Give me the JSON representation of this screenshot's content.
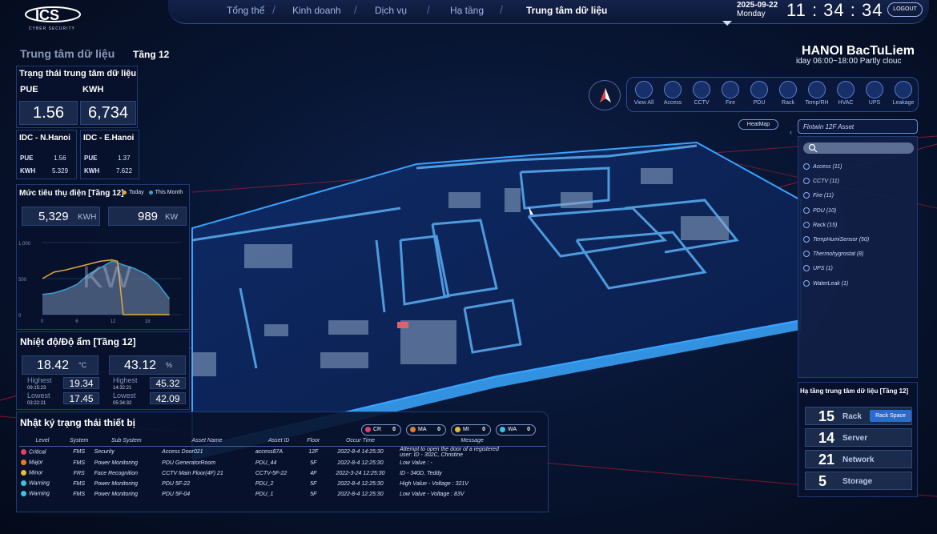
{
  "header": {
    "brand": "ICS",
    "brand_sub": "CYBER SECURITY",
    "nav": [
      "Tổng thể",
      "Kinh doanh",
      "Dịch vụ",
      "Hạ tầng",
      "Trung tâm dữ liệu"
    ],
    "active_nav": "Trung tâm dữ liệu",
    "date": "2025-09-22",
    "weekday": "Monday",
    "time": "11 : 34 : 34",
    "logout": "LOGOUT"
  },
  "breadcrumb": {
    "section": "Trung tâm dữ liệu",
    "floor": "Tầng 12"
  },
  "location": {
    "city": "HANOI BacTuLiem",
    "weather": "iday 06:00~18:00 Partly clouc"
  },
  "dc_status": {
    "title": "Trạng thái trung tâm dữ liệu",
    "pue_label": "PUE",
    "kwh_label": "KWH",
    "pue": "1.56",
    "kwh": "6,734",
    "sites": [
      {
        "name": "IDC - N.Hanoi",
        "pue_label": "PUE",
        "pue": "1.56",
        "kwh_label": "KWH",
        "kwh": "5.329"
      },
      {
        "name": "IDC - E.Hanoi",
        "pue_label": "PUE",
        "pue": "1.37",
        "kwh_label": "KWH",
        "kwh": "7.622"
      }
    ]
  },
  "power": {
    "title": "Mức tiêu thụ điện [Tầng 12]",
    "legend_today": "Today",
    "legend_month": "This Month",
    "kwh_value": "5,329",
    "kwh_unit": "KWH",
    "kw_value": "989",
    "kw_unit": "KW",
    "watermark": "KW"
  },
  "chart_data": {
    "type": "area",
    "x": [
      0,
      2,
      4,
      6,
      8,
      10,
      12,
      13,
      14,
      16,
      18,
      20,
      22
    ],
    "xticks": [
      "0",
      "6",
      "12",
      "18"
    ],
    "yticks": [
      "1,000",
      "500",
      "0"
    ],
    "ylim": [
      0,
      1000
    ],
    "series": [
      {
        "name": "Today",
        "color": "#e8a83a",
        "values": [
          500,
          590,
          620,
          660,
          700,
          740,
          760,
          740,
          0,
          0,
          0,
          0,
          0
        ]
      },
      {
        "name": "This Month",
        "color": "#35a0d8",
        "values": [
          280,
          300,
          350,
          420,
          560,
          650,
          740,
          720,
          690,
          640,
          560,
          430,
          220
        ]
      }
    ]
  },
  "climate": {
    "title": "Nhiệt độ/Độ ẩm [Tầng 12]",
    "temp": "18.42",
    "temp_unit": "°C",
    "hum": "43.12",
    "hum_unit": "%",
    "highest_label": "Highest",
    "lowest_label": "Lowest",
    "t_high_time": "09:15:23",
    "t_high": "19.34",
    "t_low_time": "03:22:21",
    "t_low": "17.45",
    "h_high_time": "14:32:21",
    "h_high": "45.32",
    "h_low_time": "05:34:32",
    "h_low": "42.09"
  },
  "log": {
    "title": "Nhật ký trạng thái thiết bị",
    "badges": [
      {
        "label": "CR",
        "count": "0",
        "color": "#e0406a"
      },
      {
        "label": "MA",
        "count": "0",
        "color": "#e67a2e"
      },
      {
        "label": "MI",
        "count": "0",
        "color": "#e0c030"
      },
      {
        "label": "WA",
        "count": "0",
        "color": "#3fc0e0"
      }
    ],
    "columns": [
      "Level",
      "System",
      "Sub System",
      "Asset Name",
      "Asset ID",
      "Floor",
      "Occur Time",
      "Message"
    ],
    "rows": [
      {
        "level": "Critical",
        "color": "#e0406a",
        "system": "FMS",
        "sub": "Security",
        "asset": "Access Door021",
        "id": "access87A",
        "floor": "12F",
        "time": "2022-8-4 14:25:30",
        "msg": "Attempt to open the door of a registered",
        "msg2": "user: ID - 302C, Christine"
      },
      {
        "level": "Major",
        "color": "#e67a2e",
        "system": "FMS",
        "sub": "Power Monitoring",
        "asset": "PDU GeneratorRoom",
        "id": "PDU_44",
        "floor": "5F",
        "time": "2022-8-4 12:25:30",
        "msg": "Low Value : -",
        "msg2": ""
      },
      {
        "level": "Minor",
        "color": "#e0c030",
        "system": "FRS",
        "sub": "Face Recognition",
        "asset": "CCTV Main Floor(4F) 21",
        "id": "CCTV-5F-22",
        "floor": "4F",
        "time": "2022-3-24 12:25:30",
        "msg": "ID - 340D, Teddy",
        "msg2": ""
      },
      {
        "level": "Warning",
        "color": "#3fc0e0",
        "system": "FMS",
        "sub": "Power Monitoring",
        "asset": "PDU 5F-22",
        "id": "PDU_2",
        "floor": "5F",
        "time": "2022-8-4 12:25:30",
        "msg": "High Value - Voltage : 321V",
        "msg2": ""
      },
      {
        "level": "Warning",
        "color": "#3fc0e0",
        "system": "FMS",
        "sub": "Power Monitoring",
        "asset": "PDU 5F-04",
        "id": "PDU_1",
        "floor": "5F",
        "time": "2022-8-4 12:25:30",
        "msg": "Low Value - Voltage : 83V",
        "msg2": ""
      }
    ]
  },
  "toolbar": [
    {
      "label": "View All"
    },
    {
      "label": "Access"
    },
    {
      "label": "CCTV"
    },
    {
      "label": "Fire"
    },
    {
      "label": "PDU"
    },
    {
      "label": "Rack"
    },
    {
      "label": "Temp/RH"
    },
    {
      "label": "HVAC"
    },
    {
      "label": "UPS"
    },
    {
      "label": "Leakage"
    }
  ],
  "heatmap": "HeatMap",
  "asset_tree": {
    "title": "Fintwin 12F Asset",
    "items": [
      "Access (11)",
      "CCTV (11)",
      "Fire (11)",
      "PDU (10)",
      "Rack (15)",
      "TempHumiSensor (50)",
      "Thermohygrostat (8)",
      "UPS (1)",
      "WaterLeak (1)"
    ]
  },
  "infra": {
    "title": "Hạ tầng trung tâm dữ liệu [Tầng 12]",
    "rack_space": "Rack Space",
    "items": [
      {
        "num": "15",
        "label": "Rack"
      },
      {
        "num": "14",
        "label": "Server"
      },
      {
        "num": "21",
        "label": "Network"
      },
      {
        "num": "5",
        "label": "Storage"
      }
    ]
  }
}
